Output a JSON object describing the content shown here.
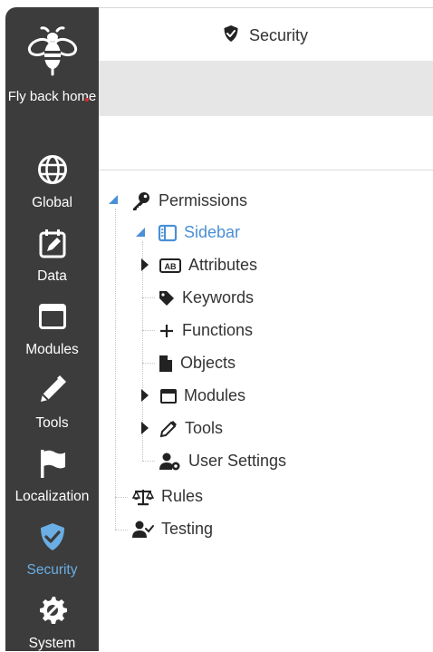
{
  "sidebar": {
    "home": {
      "label": "Fly back home",
      "icon": "bee-icon"
    },
    "items": [
      {
        "label": "Global",
        "icon": "globe-icon"
      },
      {
        "label": "Data",
        "icon": "calendar-edit-icon"
      },
      {
        "label": "Modules",
        "icon": "window-icon"
      },
      {
        "label": "Tools",
        "icon": "pencil-icon"
      },
      {
        "label": "Localization",
        "icon": "flag-icon"
      },
      {
        "label": "Security",
        "icon": "shield-check-icon",
        "active": true
      },
      {
        "label": "System",
        "icon": "gear-wrench-icon"
      }
    ],
    "active_color": "#6aaee4",
    "background": "#3c3c3c"
  },
  "header": {
    "title": "Security",
    "icon": "shield-check-icon"
  },
  "tree": {
    "root": {
      "label": "Permissions",
      "icon": "key-icon",
      "expanded": true
    },
    "children": [
      {
        "label": "Sidebar",
        "icon": "sidebar-icon",
        "expanded": true,
        "selected": true
      },
      {
        "label": "Attributes",
        "icon": "ab-tag-icon",
        "expandable": true
      },
      {
        "label": "Keywords",
        "icon": "tag-icon"
      },
      {
        "label": "Functions",
        "icon": "plus-icon"
      },
      {
        "label": "Objects",
        "icon": "file-icon"
      },
      {
        "label": "Modules",
        "icon": "window-icon",
        "expandable": true
      },
      {
        "label": "Tools",
        "icon": "pencil-icon",
        "expandable": true
      },
      {
        "label": "User Settings",
        "icon": "user-gear-icon"
      }
    ],
    "siblings": [
      {
        "label": "Rules",
        "icon": "scale-icon"
      },
      {
        "label": "Testing",
        "icon": "user-check-icon"
      }
    ],
    "selected_color": "#4a90d6"
  }
}
